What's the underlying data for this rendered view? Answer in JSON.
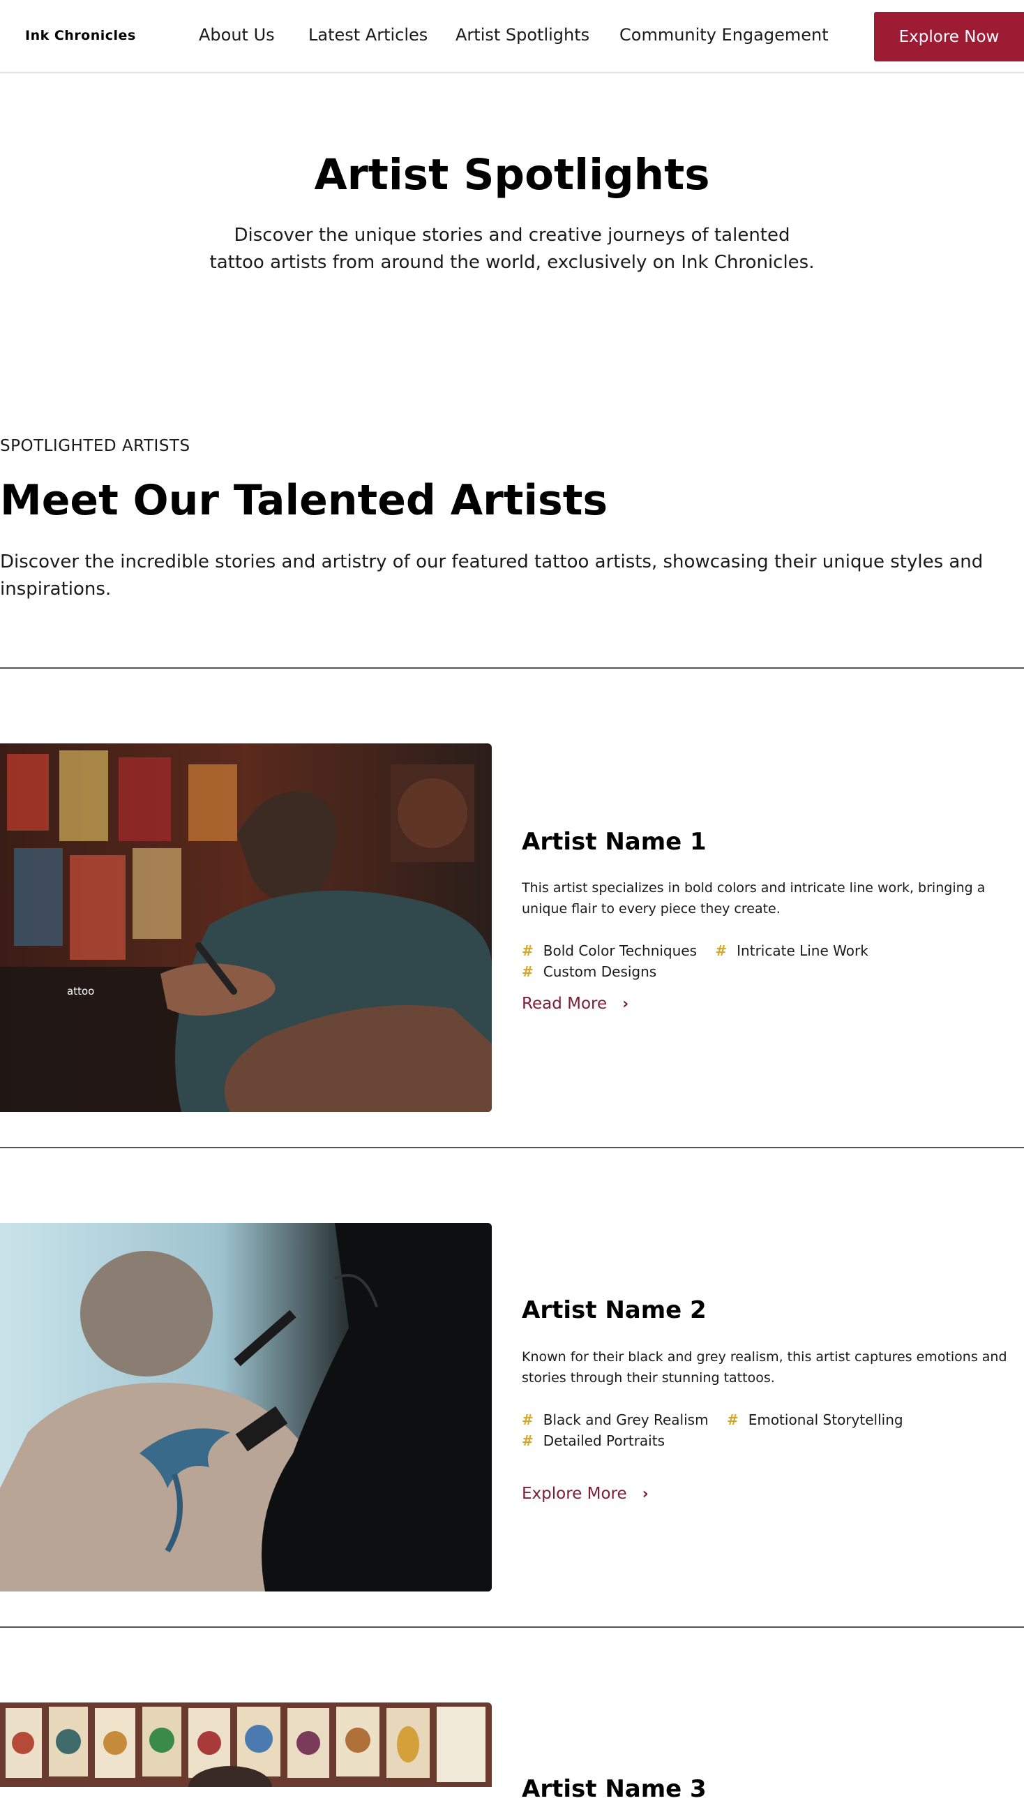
{
  "header": {
    "logo": "Ink Chronicles",
    "nav": [
      "About Us",
      "Latest Articles",
      "Artist Spotlights",
      "Community Engagement"
    ],
    "cta_label": "Explore Now"
  },
  "hero": {
    "title": "Artist Spotlights",
    "subtitle": "Discover the unique stories and creative journeys of talented tattoo artists from around the world, exclusively on Ink Chronicles."
  },
  "section": {
    "eyebrow": "SPOTLIGHTED ARTISTS",
    "title": "Meet Our Talented Artists",
    "description": "Discover the incredible stories and artistry of our featured tattoo artists, showcasing their unique styles and inspirations."
  },
  "artists": [
    {
      "name": "Artist Name 1",
      "description": "This artist specializes in bold colors and intricate line work, bringing a unique flair to every piece they create.",
      "tags": [
        "Bold Color Techniques",
        "Intricate Line Work",
        "Custom Designs"
      ],
      "link_label": "Read More",
      "image_text": "attoo"
    },
    {
      "name": "Artist Name 2",
      "description": "Known for their black and grey realism, this artist captures emotions and stories through their stunning tattoos.",
      "tags": [
        "Black and Grey Realism",
        "Emotional Storytelling",
        "Detailed Portraits"
      ],
      "link_label": "Explore More"
    },
    {
      "name": "Artist Name 3"
    }
  ],
  "icons": {
    "tag": "hash-icon",
    "link": "chevron-right-icon"
  },
  "colors": {
    "brand": "#9e1b34",
    "link": "#7c2033",
    "tag_accent": "#d4a82a"
  }
}
